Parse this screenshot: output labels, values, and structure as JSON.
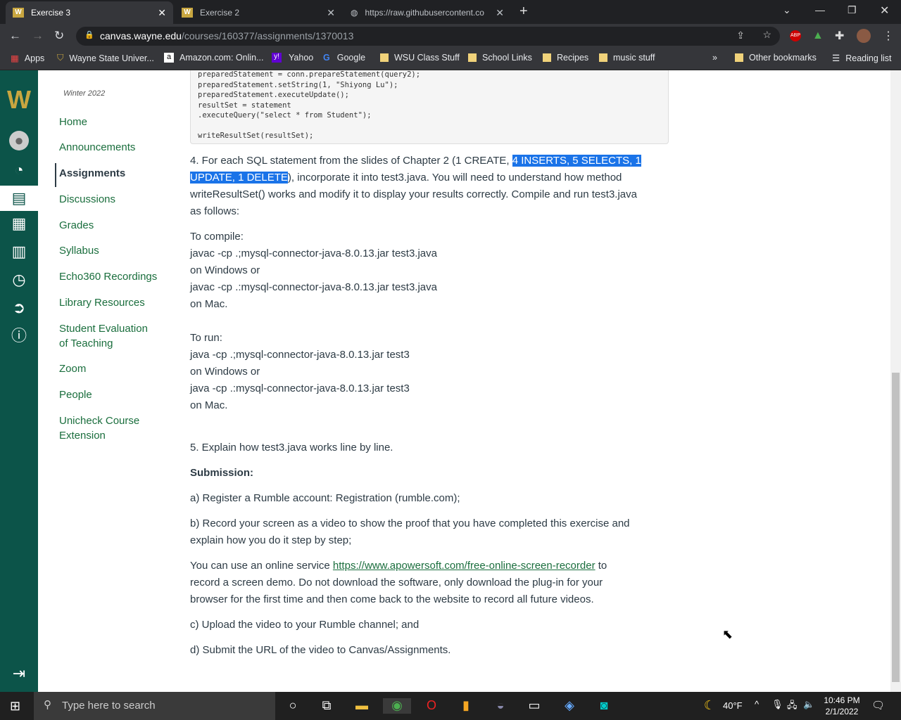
{
  "browser": {
    "tabs": [
      {
        "title": "Exercise 3",
        "active": true
      },
      {
        "title": "Exercise 2"
      },
      {
        "title": "https://raw.githubusercontent.co"
      }
    ],
    "url_host": "canvas.wayne.edu",
    "url_path": "/courses/160377/assignments/1370013",
    "bookmarks": [
      "Apps",
      "Wayne State Univer...",
      "Amazon.com: Onlin...",
      "Yahoo",
      "Google",
      "WSU Class Stuff",
      "School Links",
      "Recipes",
      "music stuff"
    ],
    "other_bookmarks": "Other bookmarks",
    "reading_list": "Reading list",
    "more": "»"
  },
  "course": {
    "term": "Winter 2022",
    "nav": [
      "Home",
      "Announcements",
      "Assignments",
      "Discussions",
      "Grades",
      "Syllabus",
      "Echo360 Recordings",
      "Library Resources",
      "Student Evaluation of Teaching",
      "Zoom",
      "People",
      "Unicheck Course Extension"
    ],
    "active": "Assignments"
  },
  "code": [
    "preparedStatement = conn.prepareStatement(query2);",
    "preparedStatement.setString(1, \"Shiyong Lu\");",
    "preparedStatement.executeUpdate();",
    "resultSet = statement",
    ".executeQuery(\"select * from Student\");",
    "",
    "writeResultSet(resultSet);"
  ],
  "content": {
    "p4a": "4. For each SQL statement from the slides of Chapter 2 (1 CREATE, ",
    "p4hl1": "4 INSERTS, 5 SELECTS, 1",
    "p4hl2": "UPDATE, 1 DELETE",
    "p4b": "),  incorporate it into test3.java. You will need to understand how method",
    "p4c": "writeResultSet() works and modify it to display your results correctly. Compile and run test3.java",
    "p4d": "as follows:",
    "compile": [
      "To compile:",
      "javac -cp .;mysql-connector-java-8.0.13.jar test3.java",
      "on Windows or",
      "javac -cp .:mysql-connector-java-8.0.13.jar test3.java",
      "on Mac."
    ],
    "run": [
      "To run:",
      "java -cp .;mysql-connector-java-8.0.13.jar test3",
      "on Windows or",
      "java -cp .:mysql-connector-java-8.0.13.jar test3",
      "on Mac."
    ],
    "p5": "5. Explain  how test3.java works line by line.",
    "submission": "Submission:",
    "a": "a) Register a Rumble account: Registration (rumble.com);",
    "b1": "b) Record your screen as a video to show the proof that you have completed this exercise and",
    "b2": "explain how you do it step by step;",
    "c1a": "You can use an online service ",
    "c1link": "https://www.apowersoft.com/free-online-screen-recorder",
    "c1b": " to",
    "c2": "record a screen demo. Do not download the software, only download the plug-in for your",
    "c3": "browser for the first time and then come back to the website to record all future videos.",
    "c": "c) Upload the video to your Rumble channel; and",
    "d": "d) Submit the URL of the video to Canvas/Assignments."
  },
  "taskbar": {
    "search_placeholder": "Type here to search",
    "weather": "40°F",
    "time": "10:46 PM",
    "date": "2/1/2022"
  },
  "colors": {
    "brand": "#0c5449",
    "link": "#1a6e3d",
    "highlight": "#1a73e8"
  }
}
